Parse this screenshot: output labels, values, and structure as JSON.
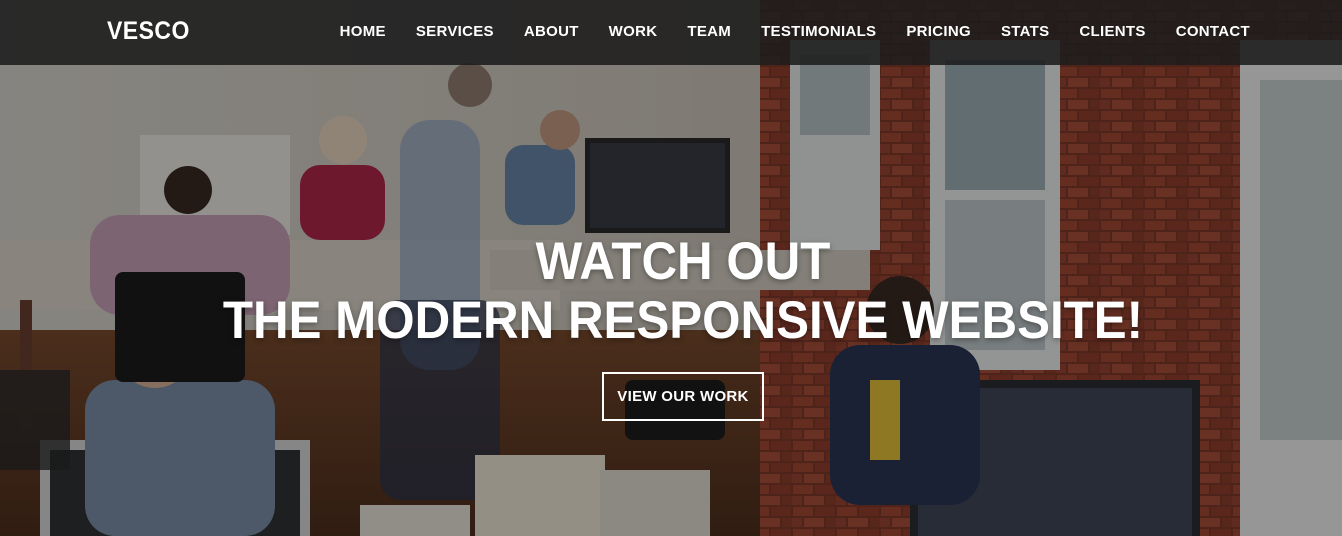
{
  "brand": "VESCO",
  "nav": {
    "items": [
      "HOME",
      "SERVICES",
      "ABOUT",
      "WORK",
      "TEAM",
      "TESTIMONIALS",
      "PRICING",
      "STATS",
      "CLIENTS",
      "CONTACT"
    ]
  },
  "hero": {
    "line1": "WATCH OUT",
    "line2": "THE MODERN RESPONSIVE WEBSITE!",
    "cta_label": "VIEW OUR WORK"
  },
  "colors": {
    "navbar_bg": "#1c1c1c",
    "text": "#ffffff",
    "brick": "#8a3b2a"
  }
}
